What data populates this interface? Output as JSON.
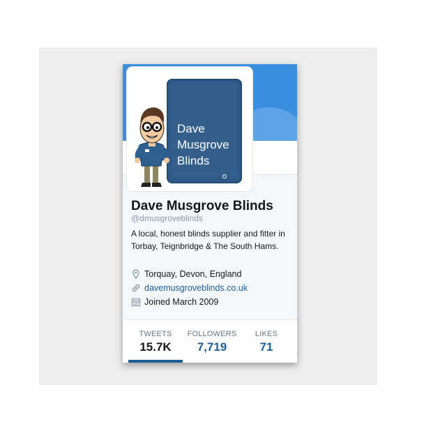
{
  "profile": {
    "avatar_text": "Dave\nMusgrove\nBlinds",
    "name": "Dave Musgrove Blinds",
    "handle": "@dmusgroveblinds",
    "bio": "A local, honest blinds supplier and fitter in Torbay, Teignbridge & The South Hams.",
    "location": "Torquay, Devon, England",
    "website": "davemusgroveblinds.co.uk",
    "joined": "Joined March 2009"
  },
  "stats": [
    {
      "label": "TWEETS",
      "value": "15.7K",
      "active": true
    },
    {
      "label": "FOLLOWERS",
      "value": "7,719"
    },
    {
      "label": "LIKES",
      "value": "71"
    }
  ],
  "icons": {
    "location": "map-pin-icon",
    "website": "link-icon",
    "joined": "calendar-icon"
  },
  "colors": {
    "banner": "#3b8fe0",
    "link": "#1b5e99",
    "tablet": "#2d5a86"
  }
}
